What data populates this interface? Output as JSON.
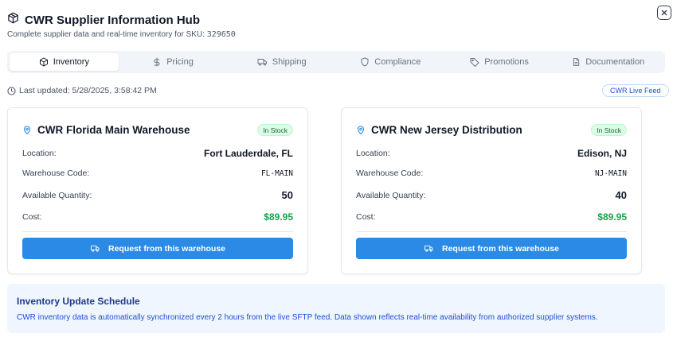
{
  "header": {
    "title": "CWR Supplier Information Hub",
    "subtitle_prefix": "Complete supplier data and real-time inventory for SKU: ",
    "sku": "329650"
  },
  "tabs": [
    {
      "label": "Inventory",
      "icon": "box-icon",
      "active": true
    },
    {
      "label": "Pricing",
      "icon": "dollar-icon",
      "active": false
    },
    {
      "label": "Shipping",
      "icon": "truck-icon",
      "active": false
    },
    {
      "label": "Compliance",
      "icon": "shield-icon",
      "active": false
    },
    {
      "label": "Promotions",
      "icon": "tag-icon",
      "active": false
    },
    {
      "label": "Documentation",
      "icon": "document-icon",
      "active": false
    }
  ],
  "status": {
    "last_updated": "Last updated: 5/28/2025, 3:58:42 PM",
    "feed_badge": "CWR Live Feed"
  },
  "labels": {
    "location": "Location:",
    "warehouse_code": "Warehouse Code:",
    "available_quantity": "Available Quantity:",
    "cost": "Cost:",
    "request_button": "Request from this warehouse"
  },
  "warehouses": [
    {
      "name": "CWR Florida Main Warehouse",
      "stock_status": "In Stock",
      "location": "Fort Lauderdale, FL",
      "code": "FL-MAIN",
      "quantity": "50",
      "cost": "$89.95"
    },
    {
      "name": "CWR New Jersey Distribution",
      "stock_status": "In Stock",
      "location": "Edison, NJ",
      "code": "NJ-MAIN",
      "quantity": "40",
      "cost": "$89.95"
    }
  ],
  "schedule": {
    "title": "Inventory Update Schedule",
    "text": "CWR inventory data is automatically synchronized every 2 hours from the live SFTP feed. Data shown reflects real-time availability from authorized supplier systems."
  },
  "colors": {
    "accent": "#2b8ae6",
    "in_stock_bg": "#dcfce7",
    "cost_green": "#16a34a",
    "info_bg": "#eff6ff"
  }
}
